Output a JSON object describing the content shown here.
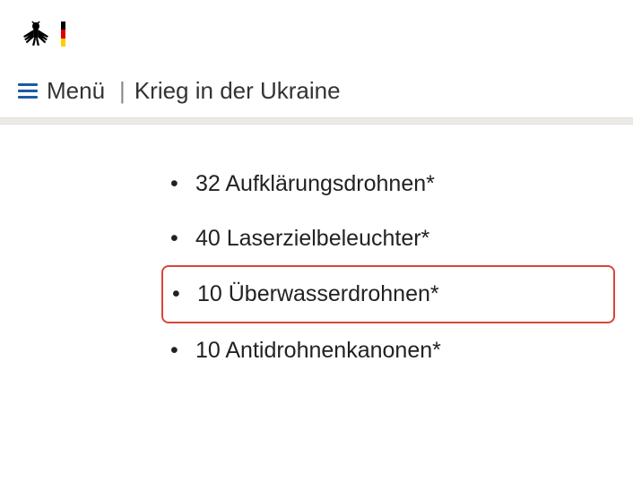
{
  "nav": {
    "menu_label": "Menü",
    "separator": "|",
    "breadcrumb": "Krieg in der Ukraine"
  },
  "content": {
    "items": [
      {
        "text": "32 Aufklärungsdrohnen*",
        "highlighted": false
      },
      {
        "text": "40 Laserzielbeleuchter*",
        "highlighted": false
      },
      {
        "text": "10 Überwasserdrohnen*",
        "highlighted": true
      },
      {
        "text": "10 Antidrohnenkanonen*",
        "highlighted": false
      }
    ]
  },
  "colors": {
    "accent": "#1d5aa5",
    "highlight_border": "#d9463a"
  }
}
